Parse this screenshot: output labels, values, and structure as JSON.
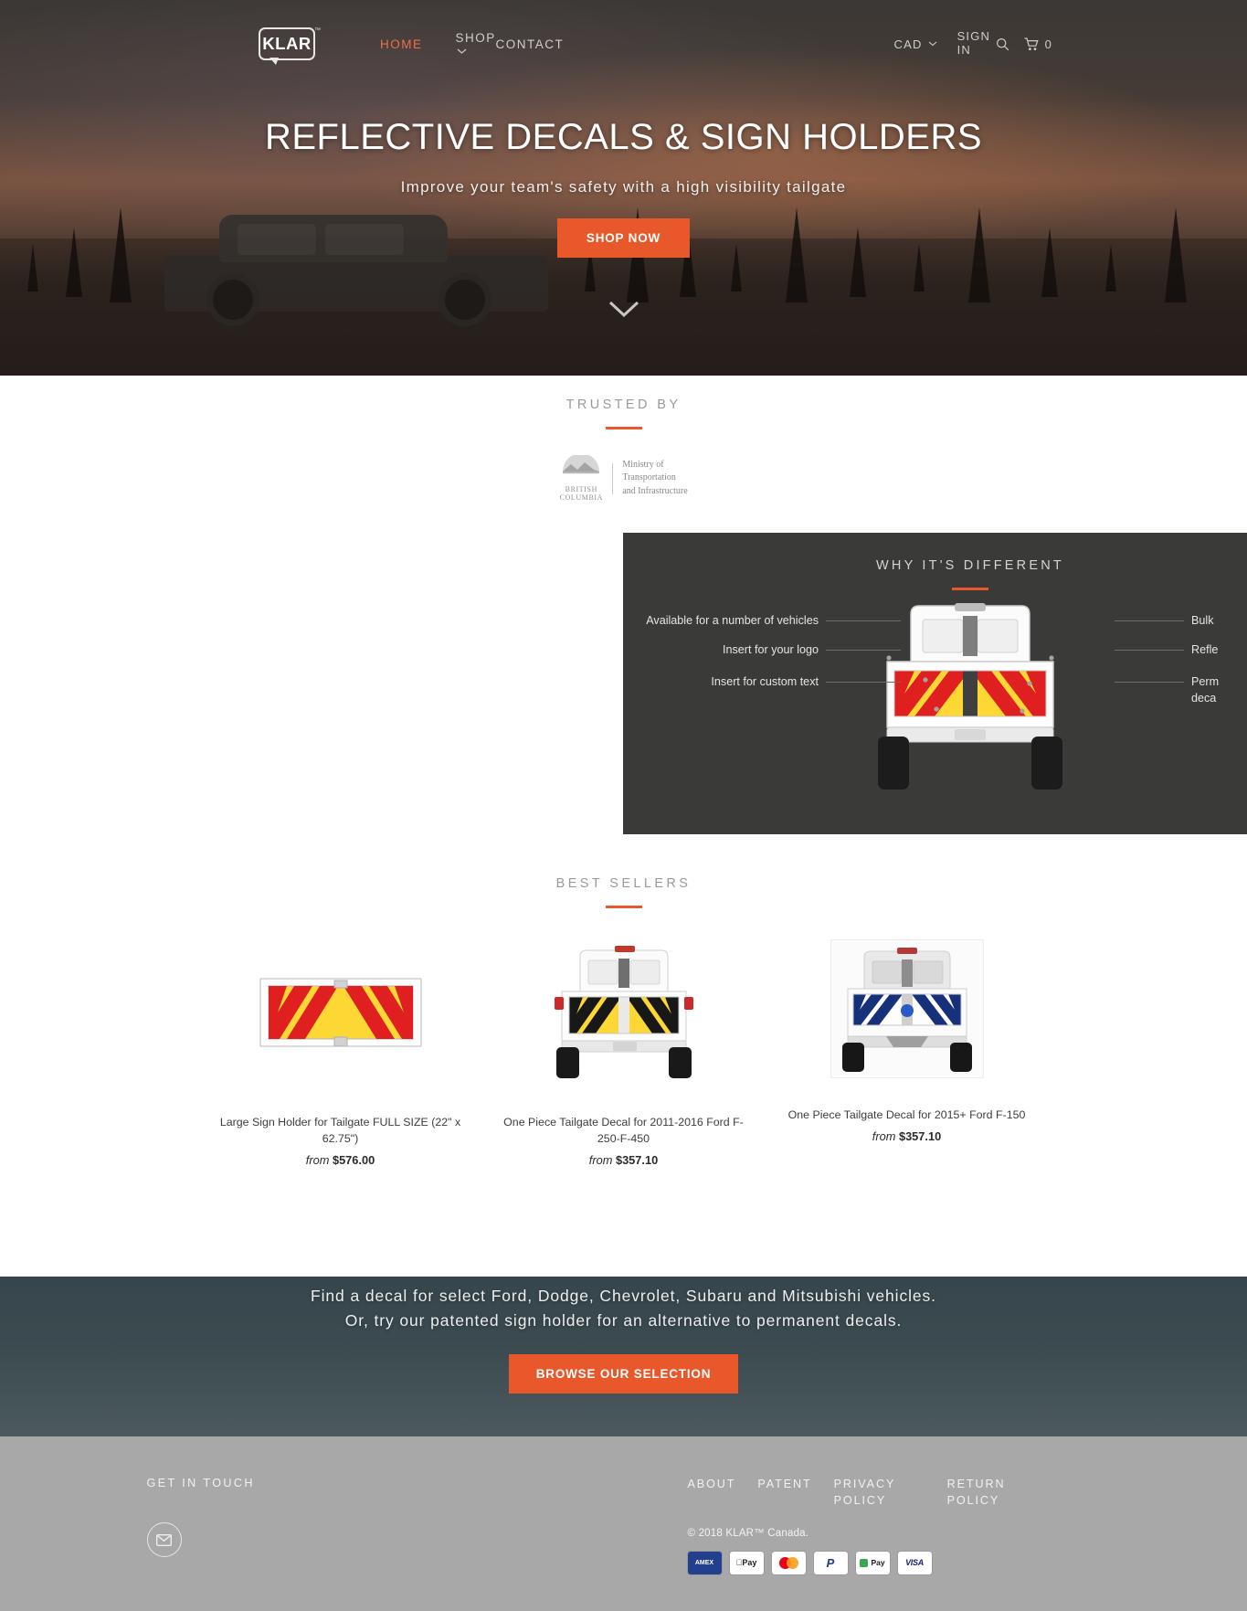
{
  "header": {
    "logo_text": "KLAR",
    "logo_tm": "™",
    "nav": [
      {
        "label": "HOME",
        "active": true
      },
      {
        "label": "SHOP",
        "active": false,
        "has_dropdown": true
      },
      {
        "label": "CONTACT",
        "active": false
      }
    ],
    "currency": "CAD",
    "sign_in": "SIGN IN",
    "search_icon": "search-icon",
    "cart_icon": "cart-icon",
    "cart_count": "0"
  },
  "hero": {
    "title": "REFLECTIVE DECALS & SIGN HOLDERS",
    "subtitle": "Improve your team's safety with a high visibility tailgate",
    "cta_label": "SHOP NOW",
    "scroll_icon": "chevron-down-icon"
  },
  "trusted": {
    "title": "TRUSTED BY",
    "logo": {
      "province_line1": "BRITISH",
      "province_line2": "COLUMBIA",
      "ministry_line1": "Ministry of",
      "ministry_line2": "Transportation",
      "ministry_line3": "and Infrastructure"
    }
  },
  "why": {
    "title": "WHY IT'S DIFFERENT",
    "labels_left": [
      "Available for a number of vehicles",
      "Insert for your logo",
      "Insert for custom text"
    ],
    "labels_right": [
      "Bulk",
      "Refle",
      "Perm\ndeca"
    ],
    "labels_right_1": "Bulk",
    "labels_right_2": "Refle",
    "labels_right_3a": "Perm",
    "labels_right_3b": "deca"
  },
  "best_sellers": {
    "title": "BEST SELLERS",
    "products": [
      {
        "title": "Large Sign Holder for Tailgate FULL SIZE (22\" x 62.75\")",
        "price_from": "from",
        "price": "$576.00",
        "art": "sign-holder-chevron-red-yellow"
      },
      {
        "title": "One Piece Tailgate Decal for 2011-2016 Ford F-250-F-450",
        "price_from": "from",
        "price": "$357.10",
        "art": "truck-decal-yellow-black"
      },
      {
        "title": "One Piece Tailgate Decal for 2015+ Ford F-150",
        "price_from": "from",
        "price": "$357.10",
        "art": "truck-decal-blue-white"
      }
    ]
  },
  "cta": {
    "line1": "Find a decal for select Ford, Dodge, Chevrolet, Subaru and Mitsubishi vehicles.",
    "line2": "Or, try our patented sign holder for an alternative to permanent decals.",
    "button": "BROWSE OUR SELECTION"
  },
  "footer": {
    "get_in_touch": "GET IN TOUCH",
    "mail_icon": "envelope-icon",
    "links": [
      {
        "label": "ABOUT"
      },
      {
        "label": "PATENT"
      },
      {
        "label_line1": "PRIVACY",
        "label_line2": "POLICY"
      },
      {
        "label_line1": "RETURN",
        "label_line2": "POLICY"
      }
    ],
    "copyright": "© 2018 KLAR™ Canada.",
    "payments": [
      {
        "name": "amex-icon",
        "label": "AMEX"
      },
      {
        "name": "apple-pay-icon",
        "label": "Pay"
      },
      {
        "name": "mastercard-icon",
        "label": ""
      },
      {
        "name": "paypal-icon",
        "label": "P"
      },
      {
        "name": "google-pay-icon",
        "label": "Pay"
      },
      {
        "name": "visa-icon",
        "label": "VISA"
      }
    ]
  },
  "colors": {
    "accent": "#e8582a",
    "nav_active": "#e8714a",
    "panel_dark": "#3a3a38",
    "cta_bg": "#3c4b50",
    "footer_bg": "#a8a8a8"
  }
}
